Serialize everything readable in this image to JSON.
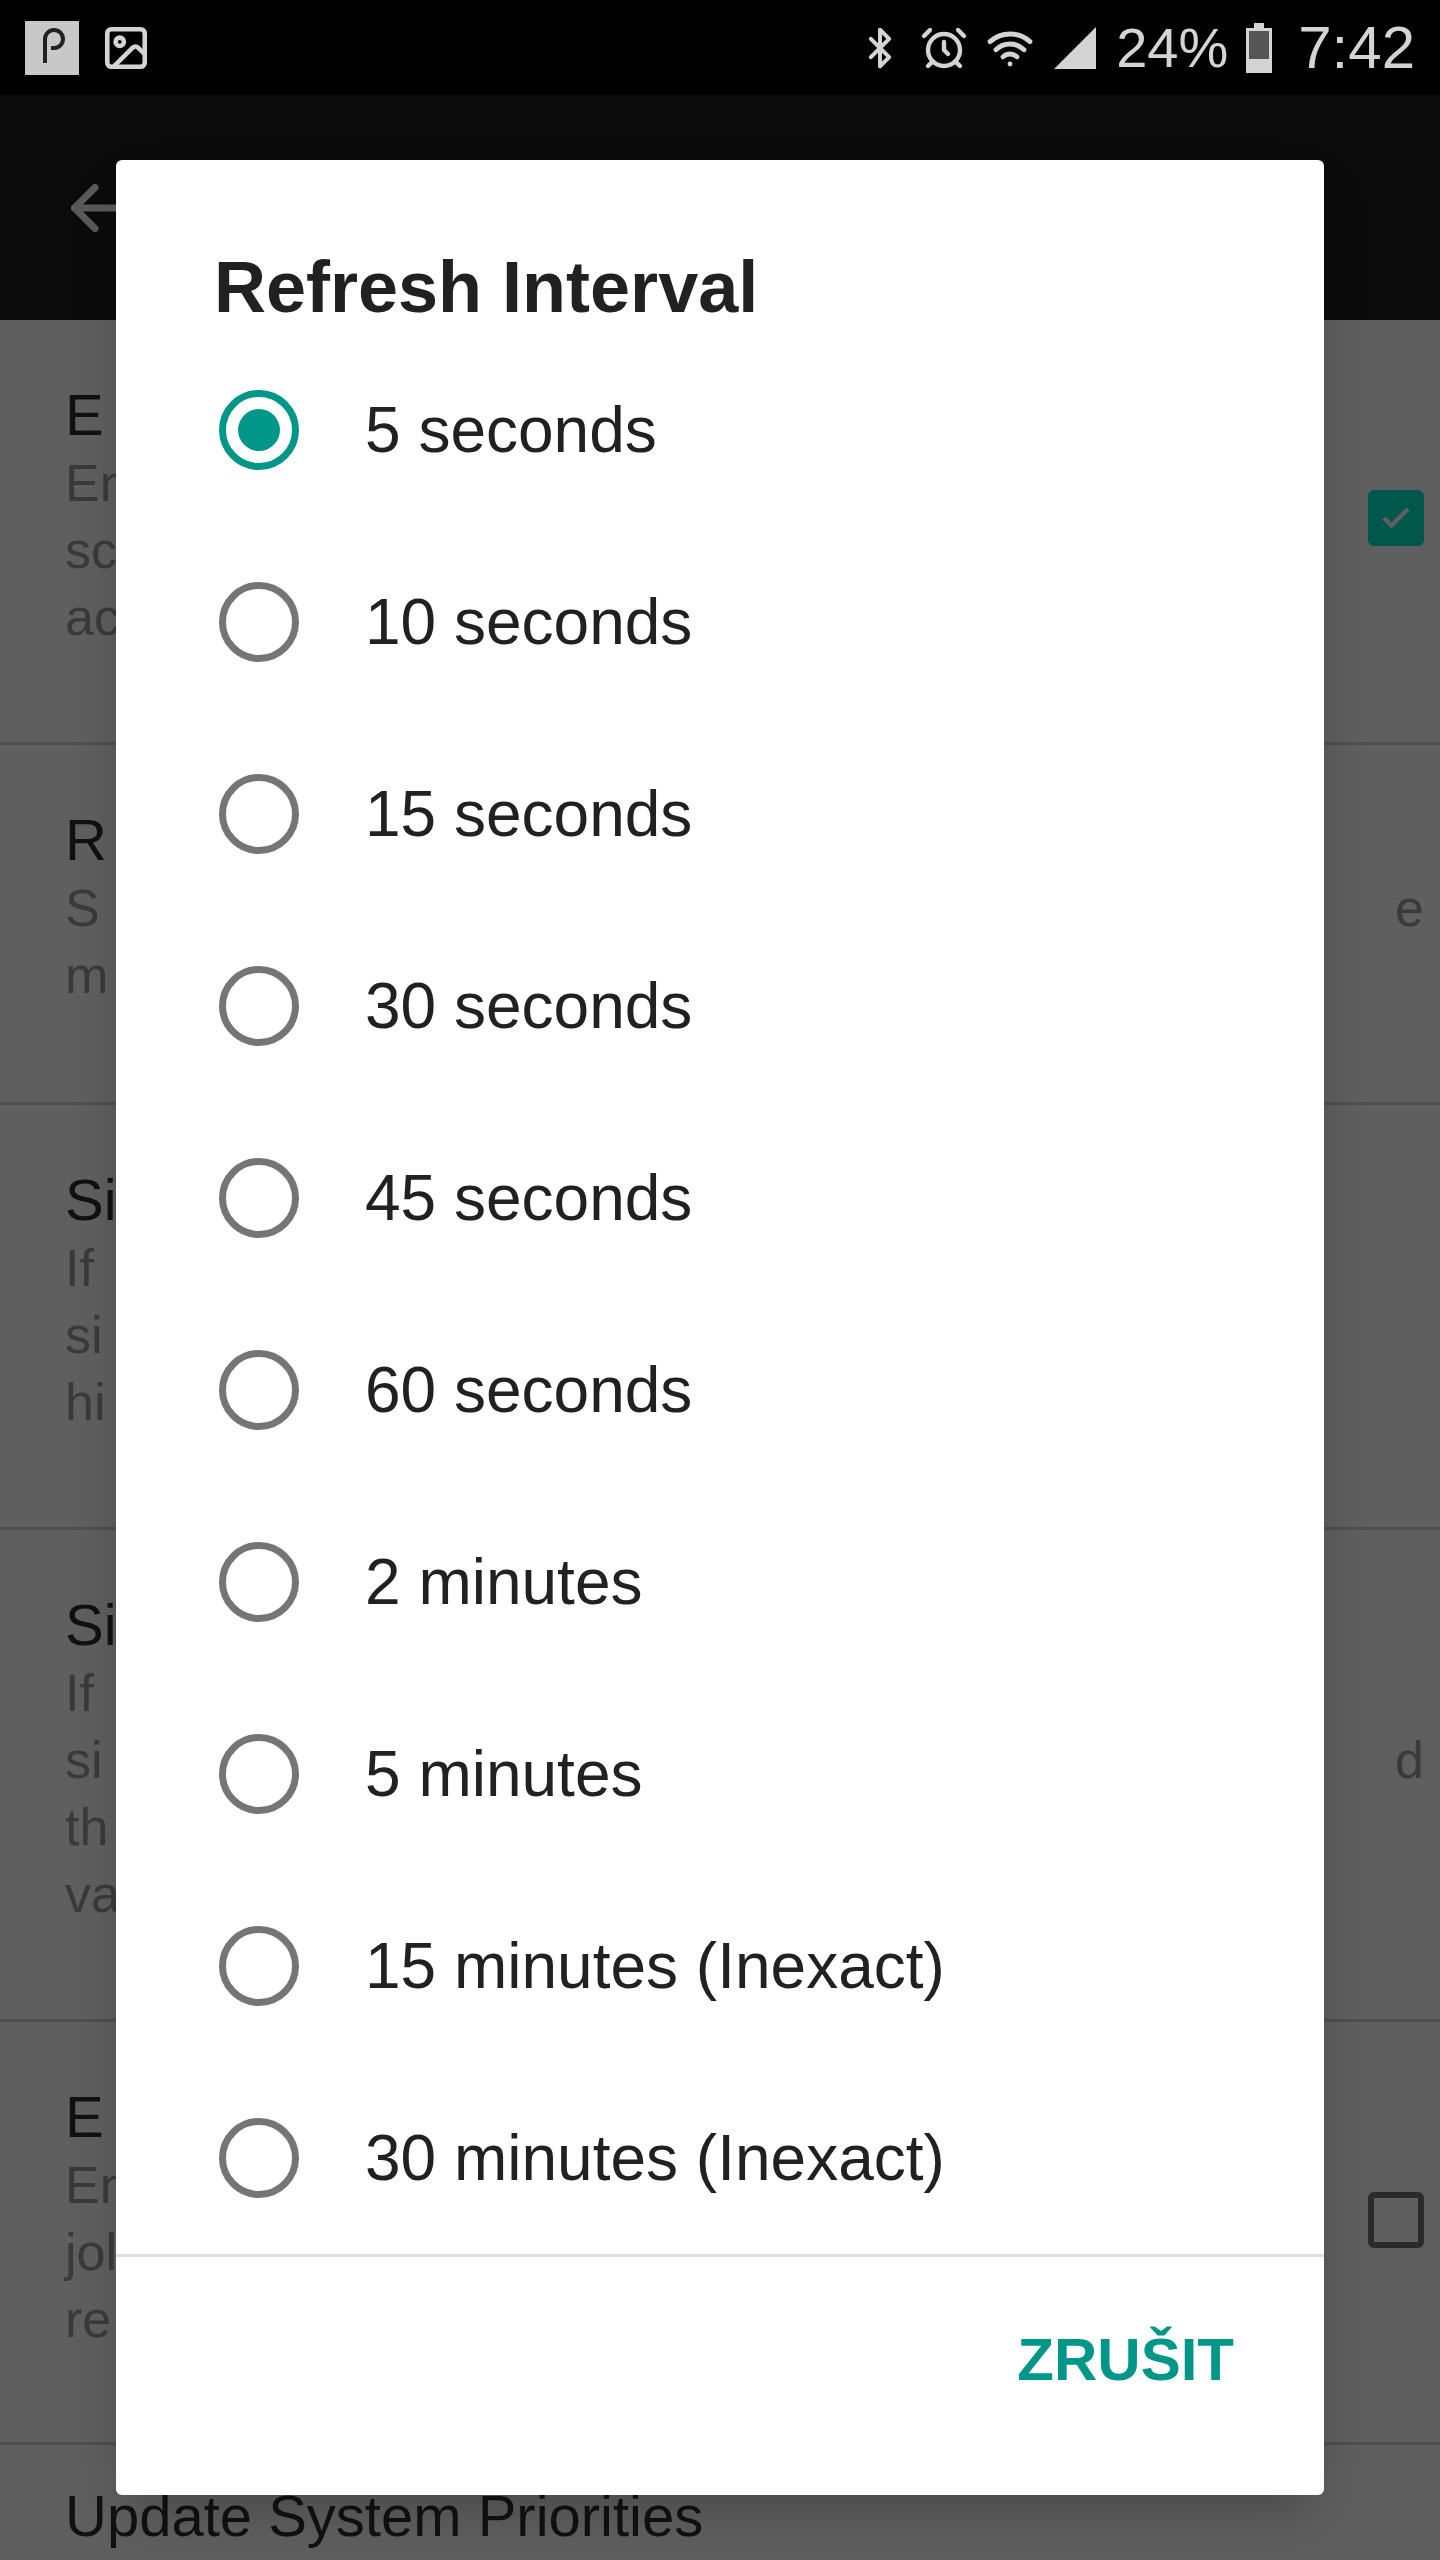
{
  "status_bar": {
    "battery": "24%",
    "time": "7:42"
  },
  "background": {
    "items": [
      {
        "title": "E",
        "lines": [
          {
            "start": "En"
          },
          {
            "start": "sc"
          },
          {
            "start": "ac"
          }
        ],
        "control": {
          "kind": "checkbox",
          "checked": true
        }
      },
      {
        "title": "R",
        "lines": [
          {
            "start": "S",
            "end": "e"
          },
          {
            "start": "m"
          }
        ]
      },
      {
        "title": "Si",
        "lines": [
          {
            "start": "If"
          },
          {
            "start": "si"
          },
          {
            "start": "hi"
          }
        ]
      },
      {
        "title": "Si",
        "lines": [
          {
            "start": "If"
          },
          {
            "start": "si",
            "end": "d"
          },
          {
            "start": "th"
          },
          {
            "start": "va"
          }
        ]
      },
      {
        "title": "E",
        "lines": [
          {
            "start": "En"
          },
          {
            "start": "jol"
          },
          {
            "start": "re"
          }
        ],
        "control": {
          "kind": "checkbox",
          "checked": false
        }
      },
      {
        "title": "Update System Priorities"
      }
    ]
  },
  "dialog": {
    "title": "Refresh Interval",
    "options": [
      {
        "label": "5 seconds",
        "selected": true
      },
      {
        "label": "10 seconds",
        "selected": false
      },
      {
        "label": "15 seconds",
        "selected": false
      },
      {
        "label": "30 seconds",
        "selected": false
      },
      {
        "label": "45 seconds",
        "selected": false
      },
      {
        "label": "60 seconds",
        "selected": false
      },
      {
        "label": "2 minutes",
        "selected": false
      },
      {
        "label": "5 minutes",
        "selected": false
      },
      {
        "label": "15 minutes (Inexact)",
        "selected": false
      },
      {
        "label": "30 minutes (Inexact)",
        "selected": false
      }
    ],
    "button": "ZRUŠIT"
  }
}
